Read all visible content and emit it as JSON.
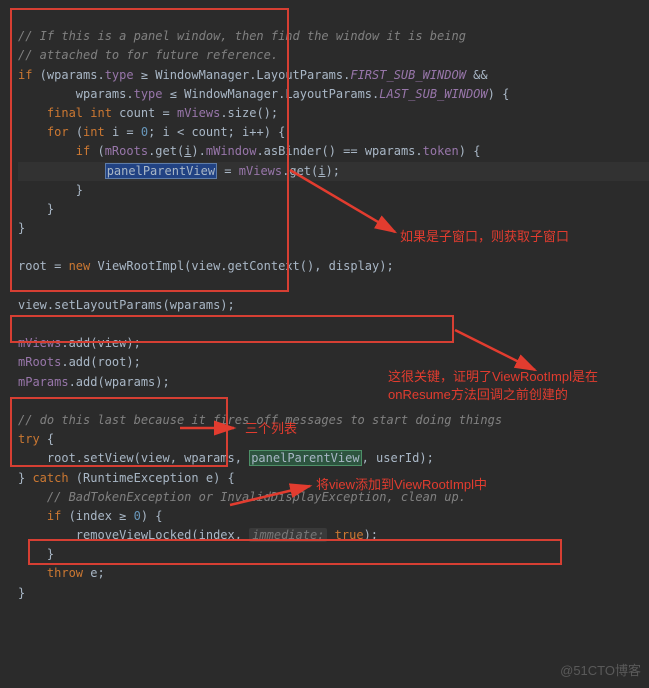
{
  "code": {
    "c1": "// If this is a panel window, then find the window it is being",
    "c2": "// attached to for future reference.",
    "l3_if": "if",
    "l3_a": " (wparams.",
    "l3_type": "type",
    "l3_b": " ≥ WindowManager.LayoutParams.",
    "l3_const1": "FIRST_SUB_WINDOW",
    "l3_c": " &&",
    "l4_a": "        wparams.",
    "l4_type": "type",
    "l4_b": " ≤ WindowManager.LayoutParams.",
    "l4_const2": "LAST_SUB_WINDOW",
    "l4_c": ") {",
    "l5_final": "final int",
    "l5_a": " count = ",
    "l5_field": "mViews",
    "l5_b": ".size();",
    "l6_for": "for",
    "l6_a": " (",
    "l6_int": "int",
    "l6_b": " i = ",
    "l6_zero": "0",
    "l6_c": "; i < count; i++) {",
    "l7_if": "if",
    "l7_a": " (",
    "l7_mroots": "mRoots",
    "l7_b": ".get(",
    "l7_i1": "i",
    "l7_c": ").",
    "l7_mwin": "mWindow",
    "l7_d": ".asBinder() == wparams.",
    "l7_token": "token",
    "l7_e": ") {",
    "l8_sel": "panelParentView",
    "l8_a": " = ",
    "l8_mviews": "mViews",
    "l8_b": ".get(",
    "l8_i2": "i",
    "l8_c": ");",
    "l9": "        }",
    "l10": "    }",
    "l11": "}",
    "l13_a": "root = ",
    "l13_new": "new",
    "l13_b": " ViewRootImpl(view.getContext(), display);",
    "l15_a": "view.setLayoutParams(wparams);",
    "l17_f1": "mViews",
    "l17_a": ".add(view);",
    "l18_f2": "mRoots",
    "l18_a": ".add(root);",
    "l19_f3": "mParams",
    "l19_a": ".add(wparams);",
    "c20": "// do this last because it fires off messages to start doing things",
    "l21_try": "try",
    "l21_a": " {",
    "l22_a": "root.setView(view, wparams, ",
    "l22_sel": "panelParentView",
    "l22_b": ", userId);",
    "l23_a": "} ",
    "l23_catch": "catch",
    "l23_b": " (RuntimeException e) {",
    "c24": "// BadTokenException or InvalidDisplayException, clean up.",
    "l25_if": "if",
    "l25_a": " (index ≥ ",
    "l25_zero": "0",
    "l25_b": ") {",
    "l26_a": "removeViewLocked(index, ",
    "l26_hint": "immediate:",
    "l26_true": " true",
    "l26_b": ");",
    "l27": "}",
    "l28_throw": "throw",
    "l28_a": " e;",
    "l29": "}"
  },
  "annotations": {
    "a1": "如果是子窗口，则获取子窗口",
    "a2_l1": "这很关键，证明了ViewRootImpl是在",
    "a2_l2": "onResume方法回调之前创建的",
    "a3": "三个列表",
    "a4": "将view添加到ViewRootImpl中"
  },
  "watermark": "@51CTO博客",
  "colors": {
    "box": "#d63f33",
    "annotation": "#e23c2f",
    "bg": "#2b2b2b"
  }
}
